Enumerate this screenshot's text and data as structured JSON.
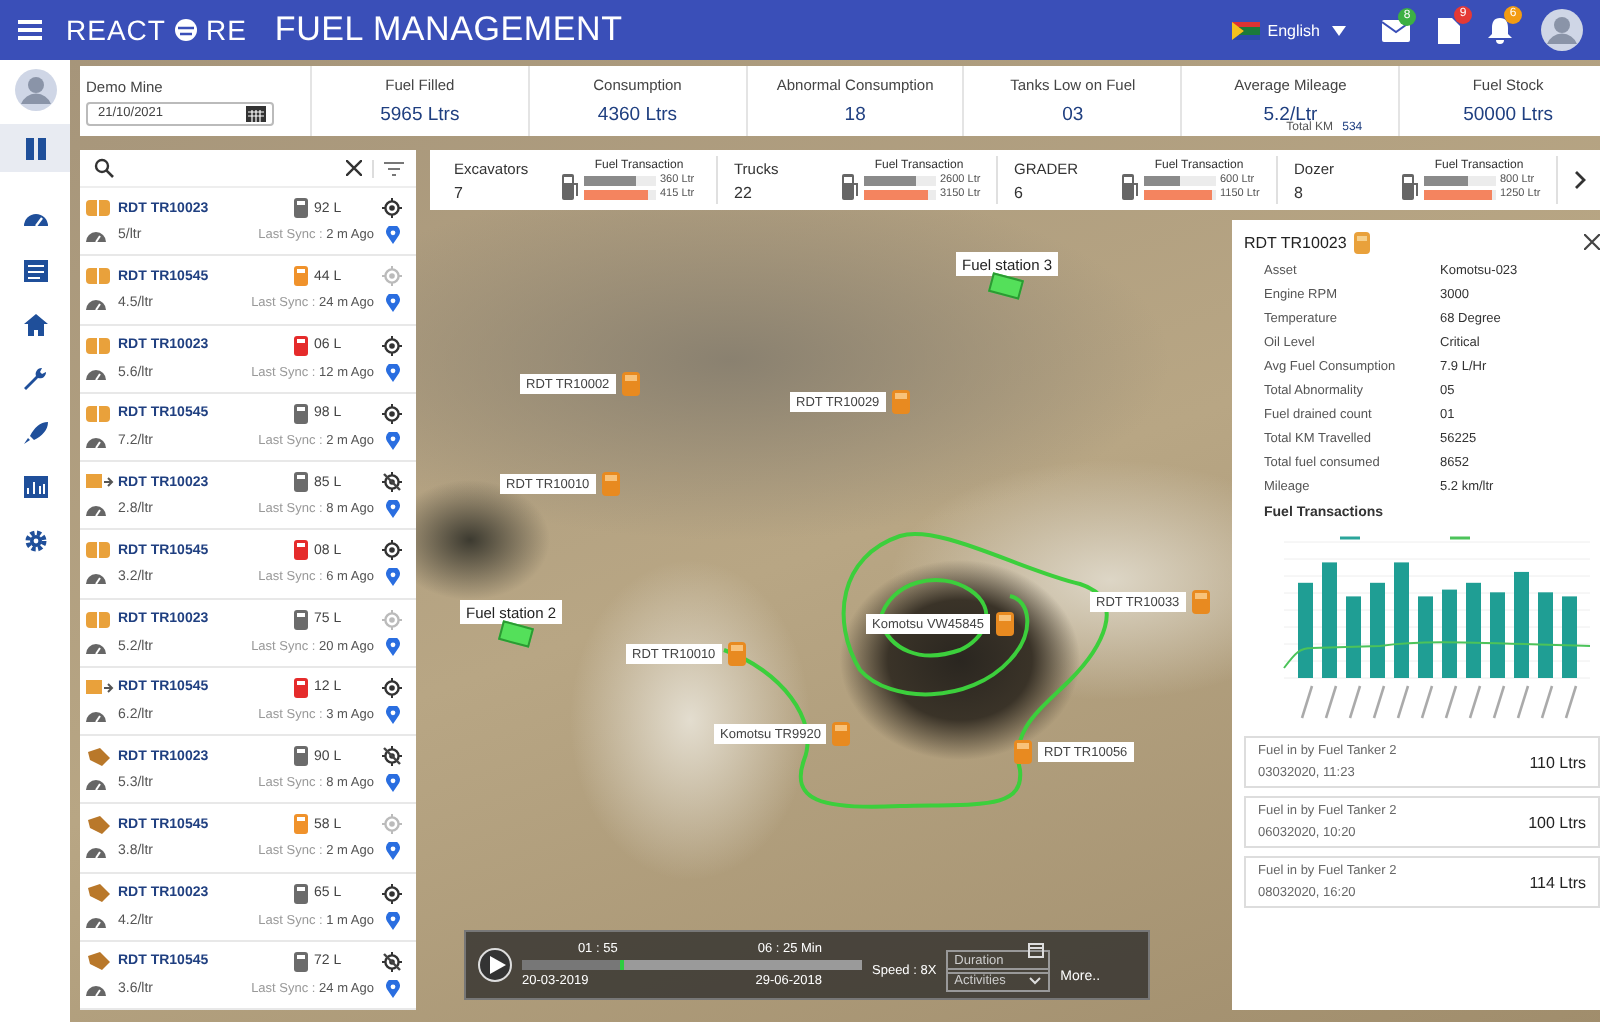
{
  "header": {
    "logo": [
      "REACT",
      "RE"
    ],
    "title": "FUEL MANAGEMENT",
    "language": "English",
    "notifications": [
      {
        "kind": "mail",
        "count": "8",
        "color": "#3cb043"
      },
      {
        "kind": "document",
        "count": "9",
        "color": "#e53935"
      },
      {
        "kind": "bell",
        "count": "6",
        "color": "#f39c12"
      }
    ]
  },
  "sidebar": {
    "items": [
      {
        "kind": "panels",
        "selected": true
      },
      {
        "kind": "gauge",
        "selected": false
      },
      {
        "kind": "list",
        "selected": false
      },
      {
        "kind": "home",
        "selected": false
      },
      {
        "kind": "wrench",
        "selected": false
      },
      {
        "kind": "rocket",
        "selected": false
      },
      {
        "kind": "chart",
        "selected": false
      },
      {
        "kind": "gear",
        "selected": false
      }
    ]
  },
  "summary": {
    "site_label": "Demo Mine",
    "date": "21/10/2021",
    "stats": [
      {
        "label": "Fuel Filled",
        "value": "5965 Ltrs"
      },
      {
        "label": "Consumption",
        "value": "4360 Ltrs"
      },
      {
        "label": "Abnormal Consumption",
        "value": "18"
      },
      {
        "label": "Tanks Low on Fuel",
        "value": "03"
      },
      {
        "label": "Average Mileage",
        "value": "5.2/Ltr",
        "sub_label": "Total KM",
        "sub_value": "534"
      },
      {
        "label": "Fuel Stock",
        "value": "50000 Ltrs"
      }
    ]
  },
  "categories": [
    {
      "name": "Excavators",
      "count": "7",
      "caption": "Fuel Transaction",
      "bars": [
        {
          "reading": "360 Ltr",
          "level": 0.72
        },
        {
          "reading": "415 Ltr",
          "level": 0.9
        }
      ]
    },
    {
      "name": "Trucks",
      "count": "22",
      "caption": "Fuel Transaction",
      "bars": [
        {
          "reading": "2600 Ltr",
          "level": 0.72
        },
        {
          "reading": "3150 Ltr",
          "level": 0.9
        }
      ]
    },
    {
      "name": "GRADER",
      "count": "6",
      "caption": "Fuel Transaction",
      "bars": [
        {
          "reading": "600 Ltr",
          "level": 0.5
        },
        {
          "reading": "1150 Ltr",
          "level": 0.95
        }
      ]
    },
    {
      "name": "Dozer",
      "count": "8",
      "caption": "Fuel Transaction",
      "bars": [
        {
          "reading": "800 Ltr",
          "level": 0.6
        },
        {
          "reading": "1250 Ltr",
          "level": 0.95
        }
      ]
    }
  ],
  "vehicle_list": {
    "items": [
      {
        "kind": "loader",
        "name": "RDT TR10023",
        "fuel": "92 L",
        "color": "#6b6b6b",
        "mileage": "5/ltr",
        "sync_label": "Last Sync :",
        "sync": "2 m Ago",
        "signal_lost": false,
        "disabled": false
      },
      {
        "kind": "loader",
        "name": "RDT TR10545",
        "fuel": "44 L",
        "color": "#f0922b",
        "mileage": "4.5/ltr",
        "sync_label": "Last Sync :",
        "sync": "24 m Ago",
        "signal_lost": false,
        "disabled": true
      },
      {
        "kind": "loader",
        "name": "RDT TR10023",
        "fuel": "06 L",
        "color": "#e52b2b",
        "mileage": "5.6/ltr",
        "sync_label": "Last Sync :",
        "sync": "12 m Ago",
        "signal_lost": false,
        "disabled": false
      },
      {
        "kind": "loader",
        "name": "RDT TR10545",
        "fuel": "98 L",
        "color": "#6b6b6b",
        "mileage": "7.2/ltr",
        "sync_label": "Last Sync :",
        "sync": "2 m Ago",
        "signal_lost": false,
        "disabled": false
      },
      {
        "kind": "truck",
        "name": "RDT TR10023",
        "fuel": "85 L",
        "color": "#6b6b6b",
        "mileage": "2.8/ltr",
        "sync_label": "Last Sync :",
        "sync": "8 m Ago",
        "signal_lost": true,
        "disabled": false
      },
      {
        "kind": "loader",
        "name": "RDT TR10545",
        "fuel": "08 L",
        "color": "#e52b2b",
        "mileage": "3.2/ltr",
        "sync_label": "Last Sync :",
        "sync": "6 m Ago",
        "signal_lost": false,
        "disabled": false
      },
      {
        "kind": "loader",
        "name": "RDT TR10023",
        "fuel": "75 L",
        "color": "#6b6b6b",
        "mileage": "5.2/ltr",
        "sync_label": "Last Sync :",
        "sync": "20 m Ago",
        "signal_lost": false,
        "disabled": true
      },
      {
        "kind": "truck",
        "name": "RDT TR10545",
        "fuel": "12 L",
        "color": "#e52b2b",
        "mileage": "6.2/ltr",
        "sync_label": "Last Sync :",
        "sync": "3 m Ago",
        "signal_lost": false,
        "disabled": false
      },
      {
        "kind": "dozer",
        "name": "RDT TR10023",
        "fuel": "90 L",
        "color": "#6b6b6b",
        "mileage": "5.3/ltr",
        "sync_label": "Last Sync :",
        "sync": "8 m Ago",
        "signal_lost": true,
        "disabled": false
      },
      {
        "kind": "dozer",
        "name": "RDT TR10545",
        "fuel": "58 L",
        "color": "#f0922b",
        "mileage": "3.8/ltr",
        "sync_label": "Last Sync :",
        "sync": "2 m Ago",
        "signal_lost": false,
        "disabled": true
      },
      {
        "kind": "dozer",
        "name": "RDT TR10023",
        "fuel": "65 L",
        "color": "#6b6b6b",
        "mileage": "4.2/ltr",
        "sync_label": "Last Sync :",
        "sync": "1 m Ago",
        "signal_lost": false,
        "disabled": false
      },
      {
        "kind": "dozer",
        "name": "RDT TR10545",
        "fuel": "72 L",
        "color": "#6b6b6b",
        "mileage": "3.6/ltr",
        "sync_label": "Last Sync :",
        "sync": "24 m Ago",
        "signal_lost": true,
        "disabled": false
      }
    ]
  },
  "map": {
    "markers": [
      {
        "kind": "station",
        "label": "Fuel station 3"
      },
      {
        "kind": "vehicle",
        "label": "RDT TR10002"
      },
      {
        "kind": "vehicle",
        "label": "RDT TR10029"
      },
      {
        "kind": "vehicle",
        "label": "RDT TR10010"
      },
      {
        "kind": "station",
        "label": "Fuel station 2"
      },
      {
        "kind": "vehicle",
        "label": "RDT TR10010"
      },
      {
        "kind": "vehicle",
        "label": "Komotsu VW45845"
      },
      {
        "kind": "vehicle",
        "label": "RDT TR10033"
      },
      {
        "kind": "vehicle",
        "label": "Komotsu TR9920"
      },
      {
        "kind": "vehicle",
        "label": "RDT TR10056"
      }
    ]
  },
  "detail": {
    "title": "RDT TR10023",
    "fields": [
      {
        "label": "Asset",
        "value": "Komotsu-023"
      },
      {
        "label": "Engine RPM",
        "value": "3000"
      },
      {
        "label": "Temperature",
        "value": "68 Degree"
      },
      {
        "label": "Oil Level",
        "value": "Critical"
      },
      {
        "label": "Avg Fuel Consumption",
        "value": "7.9 L/Hr"
      },
      {
        "label": "Total  Abnormality",
        "value": "05"
      },
      {
        "label": "Fuel drained count",
        "value": "01"
      },
      {
        "label": "Total KM Travelled",
        "value": "56225"
      },
      {
        "label": "Total fuel consumed",
        "value": "8652"
      },
      {
        "label": "Mileage",
        "value": "5.2 km/ltr"
      }
    ],
    "transactions_title": "Fuel Transactions",
    "transactions": [
      {
        "title": "Fuel in by Fuel Tanker 2",
        "time": "03032020, 11:23",
        "amount": "110 Ltrs"
      },
      {
        "title": "Fuel in by Fuel Tanker 2",
        "time": "06032020, 10:20",
        "amount": "100 Ltrs"
      },
      {
        "title": "Fuel in by Fuel Tanker 2",
        "time": "08032020, 16:20",
        "amount": "114 Ltrs"
      }
    ]
  },
  "playback": {
    "elapsed": "01 : 55",
    "total": "06 : 25  Min",
    "level": 0.3,
    "start_date": "20-03-2019",
    "end_date": "29-06-2018",
    "speed": "Speed : 8X",
    "duration_placeholder": "Duration",
    "activities": "Activities",
    "more": "More.."
  }
}
